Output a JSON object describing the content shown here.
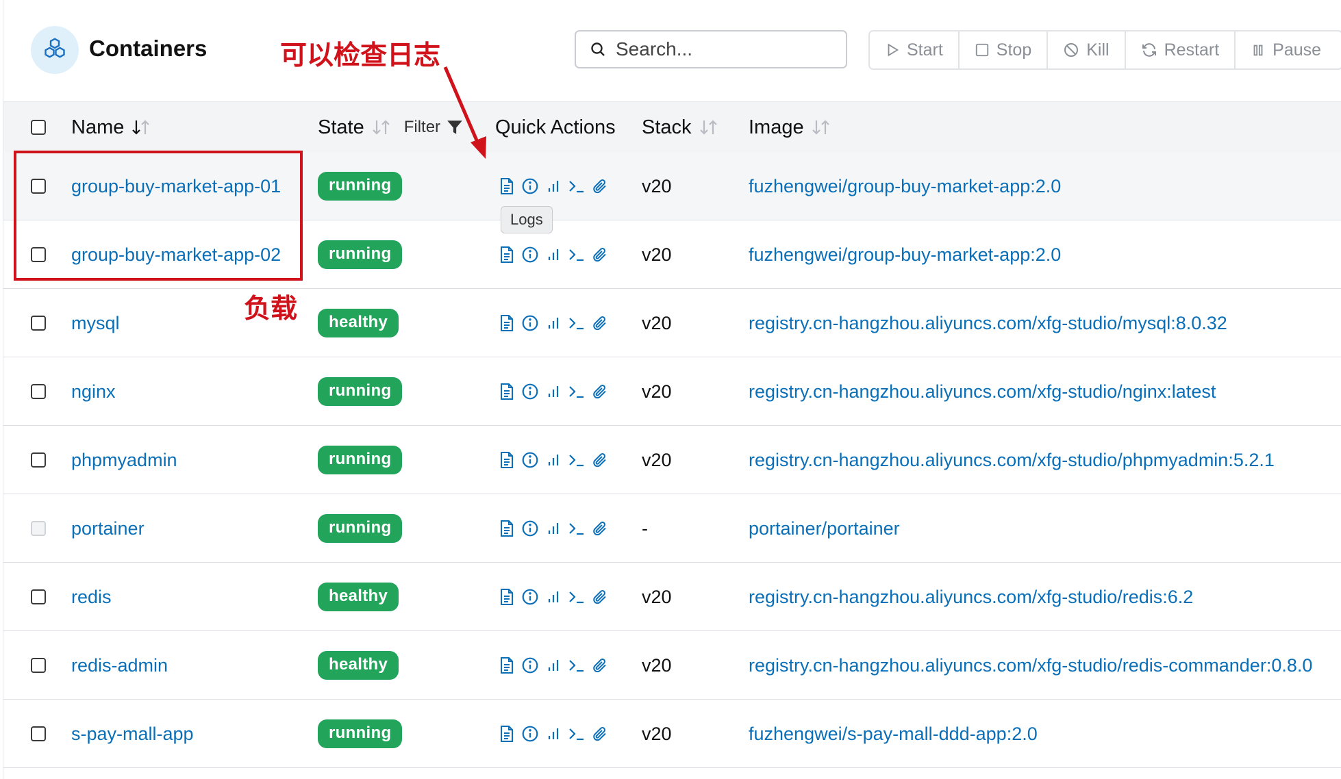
{
  "header": {
    "title": "Containers",
    "search_placeholder": "Search...",
    "actions": [
      {
        "label": "Start",
        "icon": "play-icon"
      },
      {
        "label": "Stop",
        "icon": "stop-icon"
      },
      {
        "label": "Kill",
        "icon": "ban-icon"
      },
      {
        "label": "Restart",
        "icon": "restart-icon"
      },
      {
        "label": "Pause",
        "icon": "pause-icon"
      }
    ]
  },
  "table": {
    "columns": {
      "name": "Name",
      "state": "State",
      "filter": "Filter",
      "quick_actions": "Quick Actions",
      "stack": "Stack",
      "image": "Image"
    },
    "rows": [
      {
        "name": "group-buy-market-app-01",
        "state": "running",
        "stack": "v20",
        "image": "fuzhengwei/group-buy-market-app:2.0"
      },
      {
        "name": "group-buy-market-app-02",
        "state": "running",
        "stack": "v20",
        "image": "fuzhengwei/group-buy-market-app:2.0"
      },
      {
        "name": "mysql",
        "state": "healthy",
        "stack": "v20",
        "image": "registry.cn-hangzhou.aliyuncs.com/xfg-studio/mysql:8.0.32"
      },
      {
        "name": "nginx",
        "state": "running",
        "stack": "v20",
        "image": "registry.cn-hangzhou.aliyuncs.com/xfg-studio/nginx:latest"
      },
      {
        "name": "phpmyadmin",
        "state": "running",
        "stack": "v20",
        "image": "registry.cn-hangzhou.aliyuncs.com/xfg-studio/phpmyadmin:5.2.1"
      },
      {
        "name": "portainer",
        "state": "running",
        "stack": "-",
        "image": "portainer/portainer"
      },
      {
        "name": "redis",
        "state": "healthy",
        "stack": "v20",
        "image": "registry.cn-hangzhou.aliyuncs.com/xfg-studio/redis:6.2"
      },
      {
        "name": "redis-admin",
        "state": "healthy",
        "stack": "v20",
        "image": "registry.cn-hangzhou.aliyuncs.com/xfg-studio/redis-commander:0.8.0"
      },
      {
        "name": "s-pay-mall-app",
        "state": "running",
        "stack": "v20",
        "image": "fuzhengwei/s-pay-mall-ddd-app:2.0"
      }
    ]
  },
  "tooltip": "Logs",
  "annotations": {
    "logs_note": "可以检查日志",
    "load_note": "负载"
  },
  "colors": {
    "link": "#0b6fb8",
    "badge_green": "#22a55a",
    "annotation_red": "#d0121b",
    "header_bg": "#f3f4f6"
  }
}
